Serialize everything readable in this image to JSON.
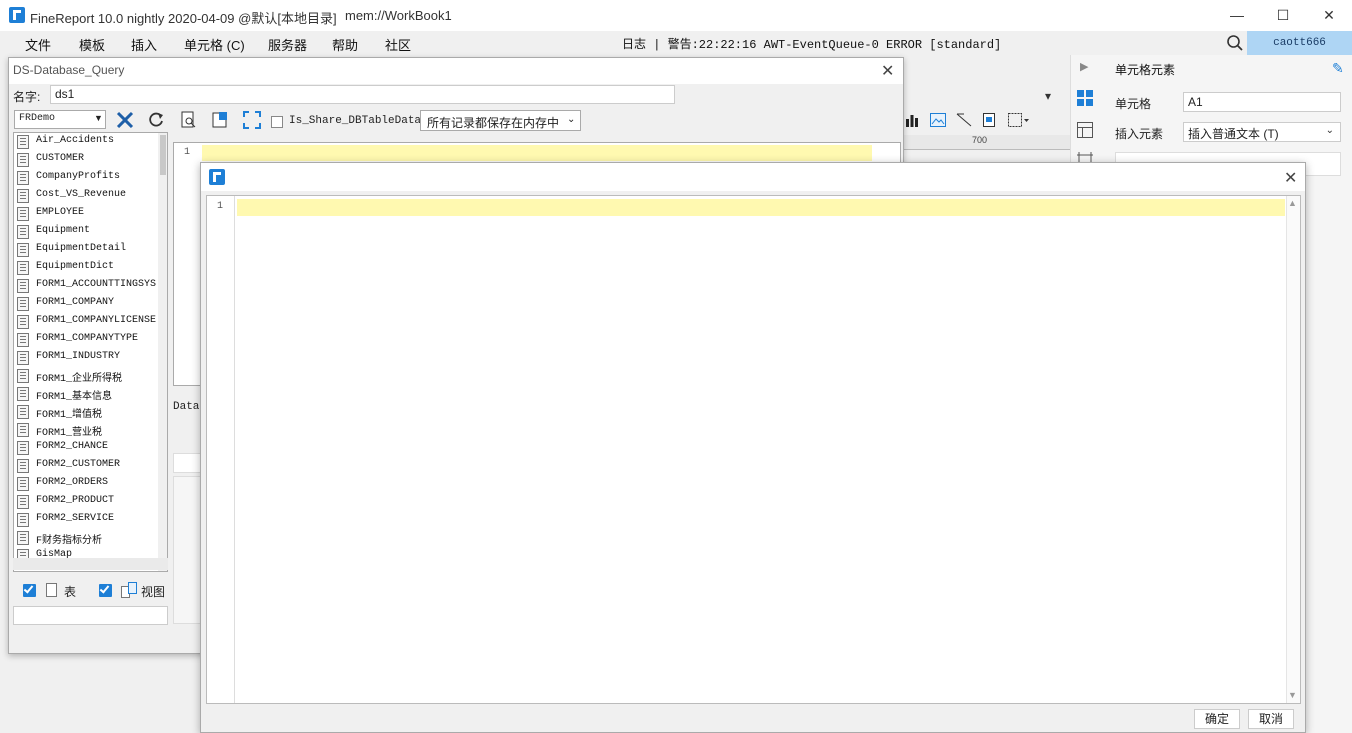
{
  "window": {
    "app_title": "FineReport 10.0 nightly 2020-04-09 @默认[本地目录]",
    "doc_title": "mem://WorkBook1",
    "minimize": "—",
    "maximize": "☐",
    "close": "✕"
  },
  "menu": {
    "items": [
      "文件",
      "模板",
      "插入",
      "单元格 (C)",
      "服务器",
      "帮助",
      "社区"
    ],
    "status": "日志 | 警告:22:22:16 AWT-EventQueue-0 ERROR [standard]",
    "user": "caott666"
  },
  "right_panel": {
    "title": "单元格元素",
    "cell_label": "单元格",
    "cell_value": "A1",
    "insert_label": "插入元素",
    "insert_value": "插入普通文本 (T)"
  },
  "ruler": {
    "label": "700"
  },
  "ds_dialog": {
    "title": "DS-Database_Query",
    "close": "✕",
    "name_label": "名字:",
    "name_value": "ds1",
    "database": "FRDemo",
    "share_label": "Is_Share_DBTableData",
    "memory_option": "所有记录都保存在内存中",
    "tables": [
      "Air_Accidents",
      "CUSTOMER",
      "CompanyProfits",
      "Cost_VS_Revenue",
      "EMPLOYEE",
      "Equipment",
      "EquipmentDetail",
      "EquipmentDict",
      "FORM1_ACCOUNTTINGSYS",
      "FORM1_COMPANY",
      "FORM1_COMPANYLICENSE",
      "FORM1_COMPANYTYPE",
      "FORM1_INDUSTRY",
      "FORM1_企业所得税",
      "FORM1_基本信息",
      "FORM1_增值税",
      "FORM1_营业税",
      "FORM2_CHANCE",
      "FORM2_CUSTOMER",
      "FORM2_ORDERS",
      "FORM2_PRODUCT",
      "FORM2_SERVICE",
      "F财务指标分析",
      "GisMap"
    ],
    "table_check_label": "表",
    "view_check_label": "视图",
    "editor_line": "1",
    "datas_label": "Datas"
  },
  "sql_dialog": {
    "close": "✕",
    "line_number": "1",
    "ok": "确定",
    "cancel": "取消"
  },
  "colors": {
    "accent": "#1e7fd6",
    "user_badge": "#aed5f4",
    "current_line": "#fff9b0"
  }
}
